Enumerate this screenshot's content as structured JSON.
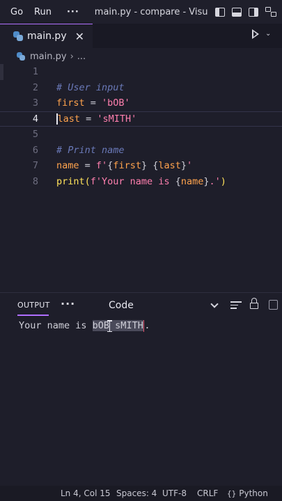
{
  "titlebar": {
    "menu": [
      "Go",
      "Run"
    ],
    "more": "···",
    "title": "main.py - compare - Visual S"
  },
  "tab": {
    "filename": "main.py",
    "close": "✕"
  },
  "breadcrumb": {
    "file": "main.py",
    "separator": "›",
    "rest": "..."
  },
  "editor": {
    "active_line": 4,
    "lines": [
      {
        "n": "1"
      },
      {
        "n": "2"
      },
      {
        "n": "3"
      },
      {
        "n": "4"
      },
      {
        "n": "5"
      },
      {
        "n": "6"
      },
      {
        "n": "7"
      },
      {
        "n": "8"
      }
    ],
    "code": {
      "l2_comment": "# User input",
      "l3_var": "first",
      "l3_op": " = ",
      "l3_str": "'bOB'",
      "l4_var": "last",
      "l4_op": " = ",
      "l4_str": "'sMITH'",
      "l6_comment": "# Print name",
      "l7_var": "name",
      "l7_op": " = ",
      "l7_fprefix": "f'",
      "l7_b1o": "{",
      "l7_i1": "first",
      "l7_b1c": "}",
      "l7_sp": " ",
      "l7_b2o": "{",
      "l7_i2": "last",
      "l7_b2c": "}",
      "l7_q": "'",
      "l8_func": "print",
      "l8_po": "(",
      "l8_str1": "f'Your name is ",
      "l8_bo": "{",
      "l8_i": "name",
      "l8_bc": "}",
      "l8_str2": ".'",
      "l8_pc": ")"
    }
  },
  "panel": {
    "tab": "OUTPUT",
    "more": "···",
    "channel": "Code",
    "output_prefix": "Your name is ",
    "output_selected": "bOB sMITH",
    "output_suffix": "."
  },
  "status": {
    "position": "Ln 4, Col 15",
    "spaces": "Spaces: 4",
    "encoding": "UTF-8",
    "eol": "CRLF",
    "language_icon": "{}",
    "language": "Python"
  }
}
